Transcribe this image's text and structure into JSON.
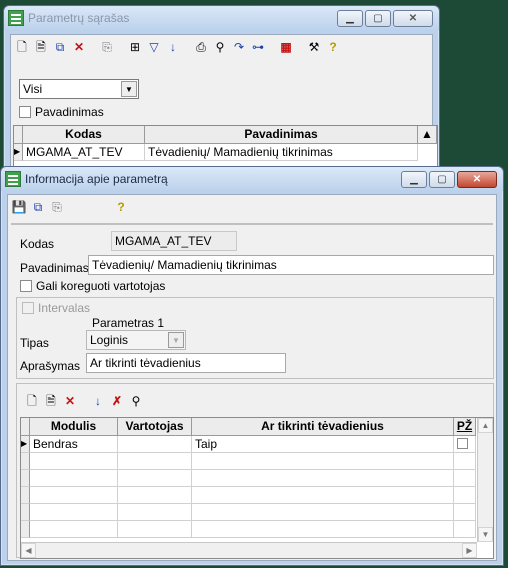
{
  "list_window": {
    "title": "Parametrų sąrašas",
    "filter_value": "Visi",
    "name_checkbox_label": "Pavadinimas",
    "columns": [
      "Kodas",
      "Pavadinimas"
    ],
    "row": {
      "code": "MGAMA_AT_TEV",
      "name": "Tėvadienių/ Mamadienių tikrinimas"
    }
  },
  "info_window": {
    "title": "Informacija apie parametrą",
    "code_label": "Kodas",
    "code_value": "MGAMA_AT_TEV",
    "name_label": "Pavadinimas",
    "name_value": "Tėvadienių/ Mamadienių tikrinimas",
    "user_editable_label": "Gali koreguoti vartotojas",
    "intervals_label": "Intervalas",
    "param_group_title": "Parametras 1",
    "type_label": "Tipas",
    "type_value": "Loginis",
    "description_label": "Aprašymas",
    "description_value": "Ar tikrinti tėvadienius",
    "grid": {
      "columns": [
        "Modulis",
        "Vartotojas",
        "Ar tikrinti tėvadienius",
        "PŽ"
      ],
      "rows": [
        {
          "module": "Bendras",
          "user": "",
          "value": "Taip"
        }
      ]
    }
  },
  "colors": {
    "desktop": "#1d4a36",
    "window_frame": "#bcd2ec",
    "close_button": "#c2472f"
  }
}
